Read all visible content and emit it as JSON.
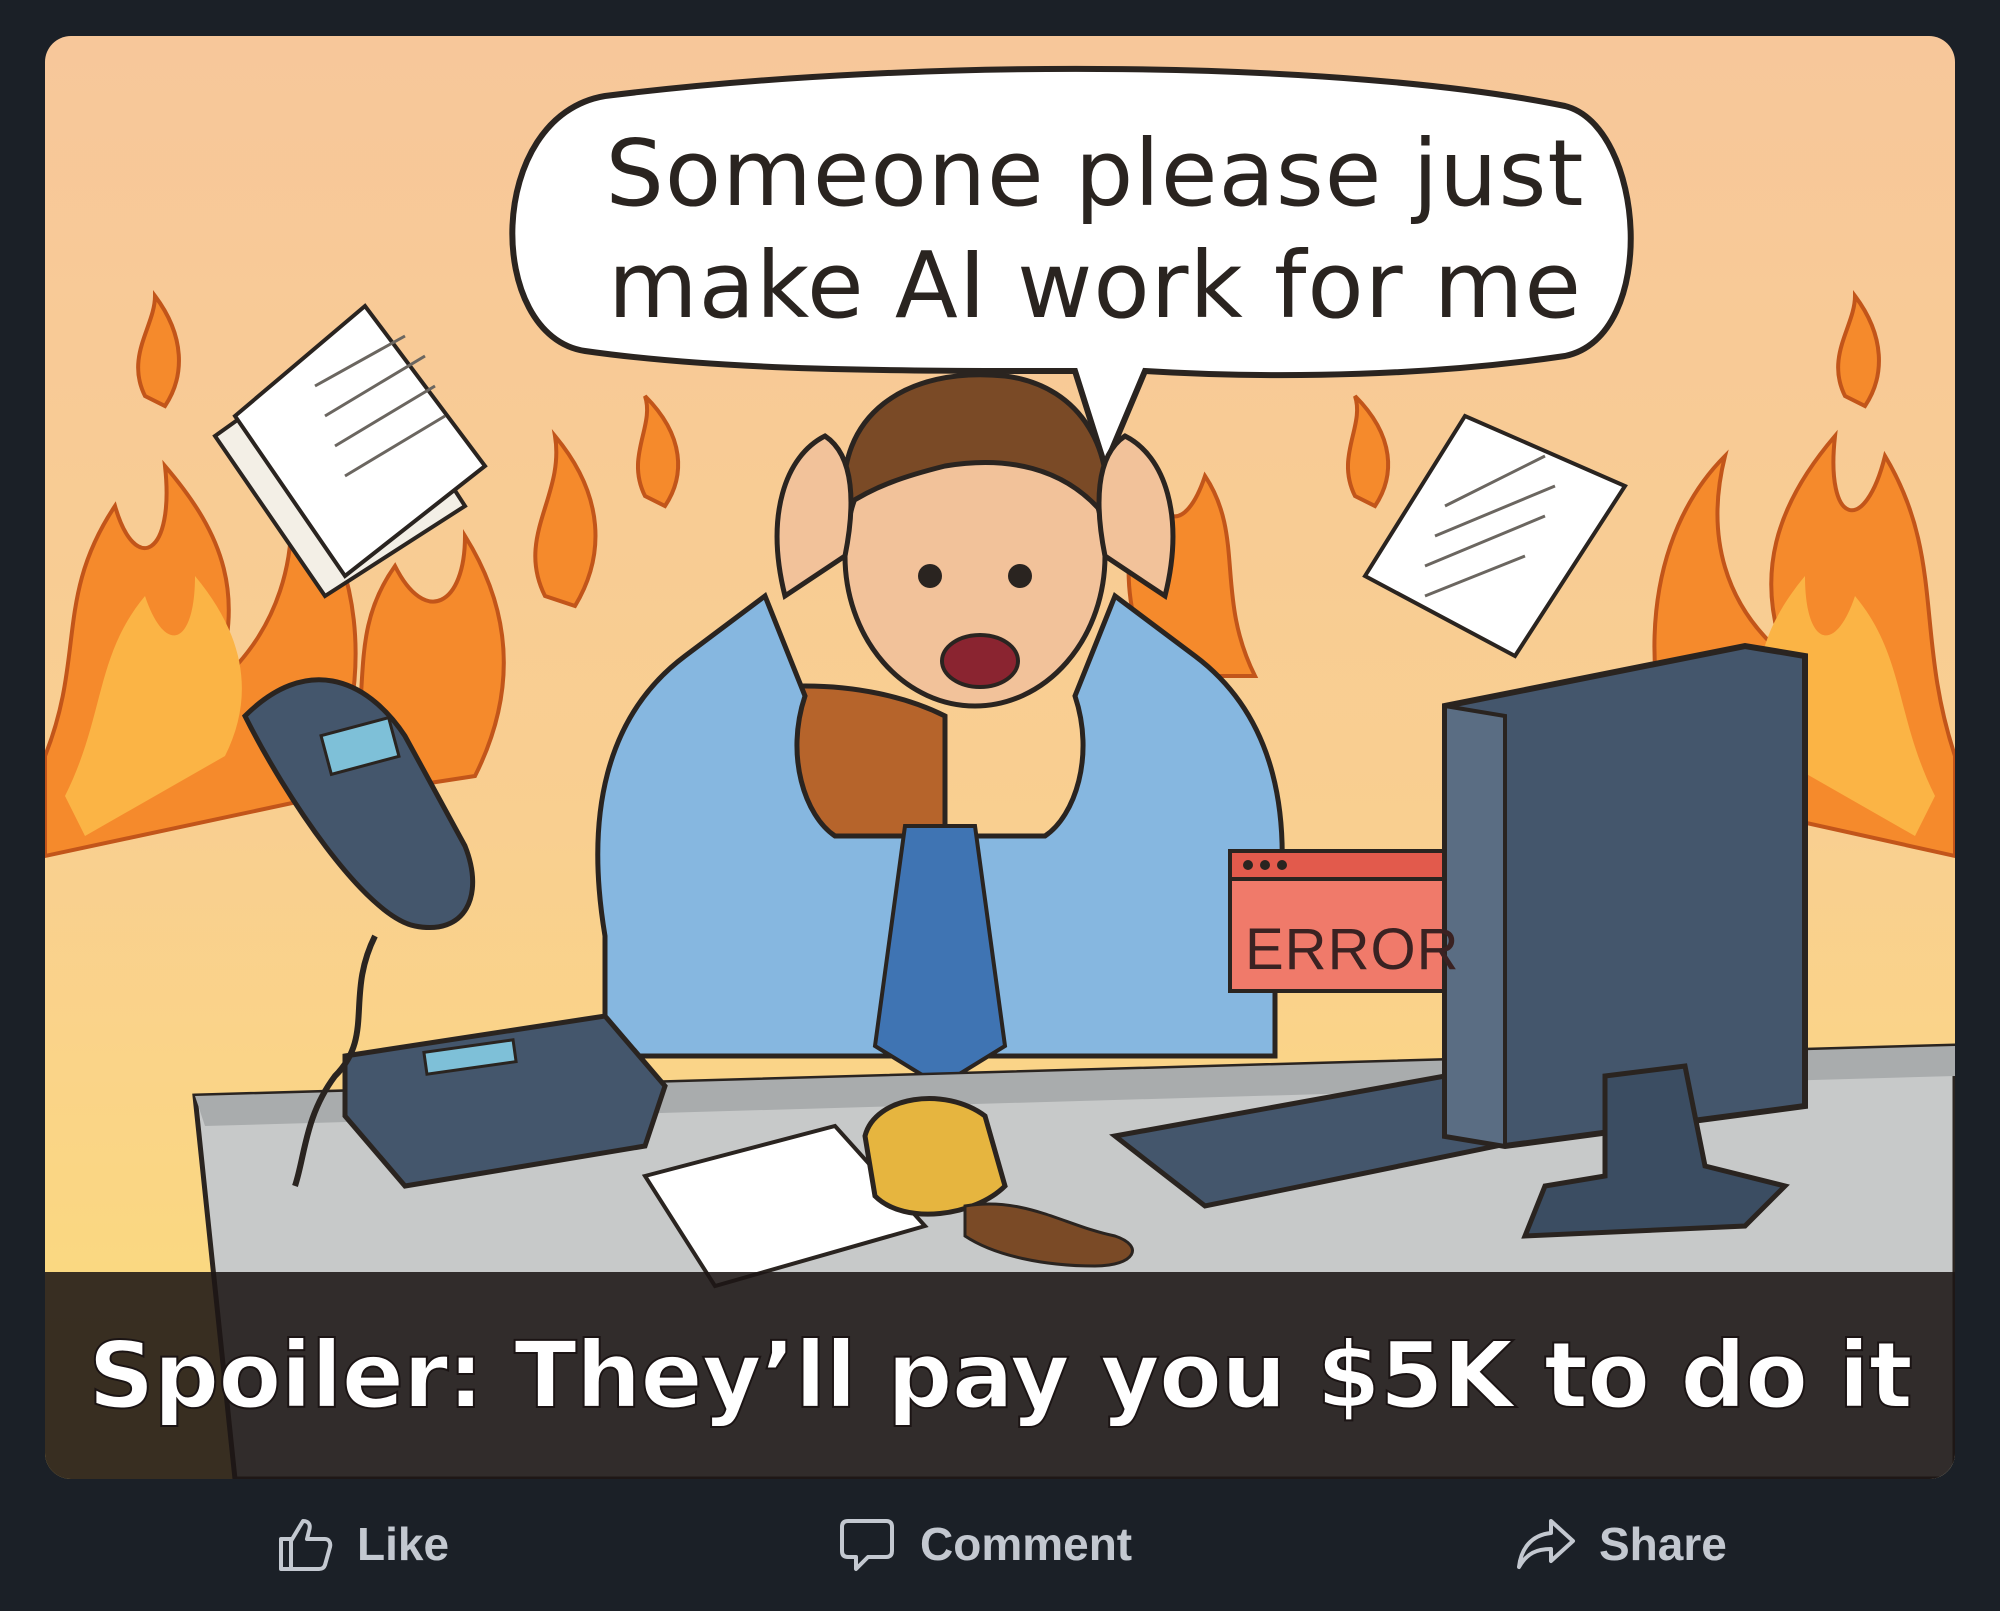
{
  "post": {
    "speech_bubble": {
      "line1": "Someone please just",
      "line2": "make AI work for me"
    },
    "error_sign": "ERROR",
    "caption": "Spoiler: They’ll pay you $5K to do it"
  },
  "actions": {
    "like": {
      "label": "Like",
      "icon": "thumbs-up-icon"
    },
    "comment": {
      "label": "Comment",
      "icon": "comment-icon"
    },
    "share": {
      "label": "Share",
      "icon": "share-arrow-icon"
    }
  },
  "colors": {
    "page_background": "#1b2027",
    "action_text": "#c3c8d0",
    "caption_bar": "#1c1614",
    "caption_text": "#ffffff"
  }
}
